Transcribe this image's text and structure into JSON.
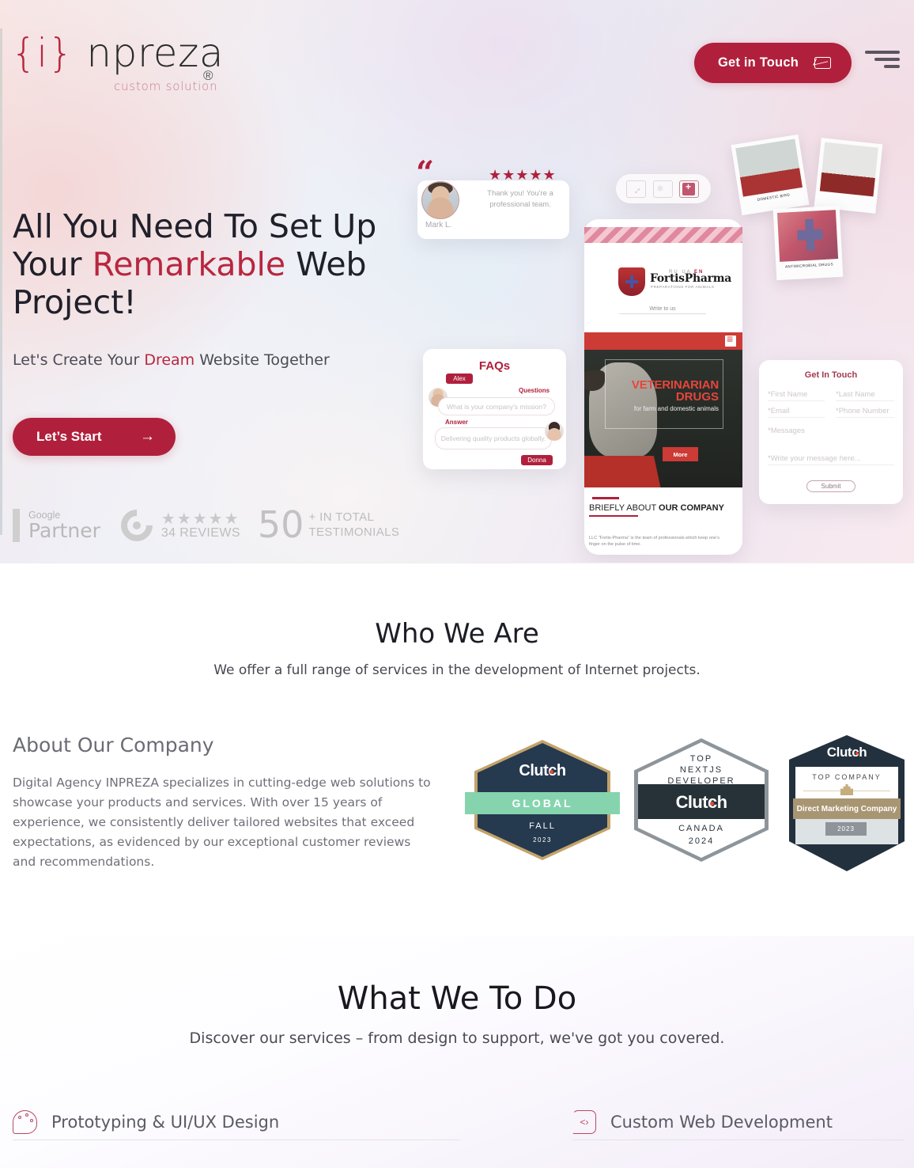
{
  "header": {
    "logo_main": "npreza",
    "logo_brace_open": "{i}",
    "logo_reg": "®",
    "logo_tagline": "custom solution",
    "cta_label": "Get in Touch",
    "cta_icon": "envelope-icon",
    "menu_icon": "hamburger-menu-icon"
  },
  "hero": {
    "title_line1": "All You Need To Set Up",
    "title_line2_a": "Your ",
    "title_line2_accent": "Remarkable",
    "title_line2_b": " Web",
    "title_line3": "Project!",
    "subtitle_a": "Let's Create Your ",
    "subtitle_accent": "Dream",
    "subtitle_b": " Website Together",
    "button_label": "Let’s Start",
    "button_arrow": "→"
  },
  "trust": {
    "google_small": "Google",
    "google_big": "Partner",
    "clutch_icon": "clutch-logo-icon",
    "stars": "★★★★★",
    "reviews": "34 REVIEWS",
    "count": "50",
    "total_line1": "+ IN TOTAL",
    "total_line2": "TESTIMONIALS"
  },
  "mock": {
    "testimonial": {
      "stars": "★★★★★",
      "text": "Thank you! You're a professional team.",
      "name": "Mark L."
    },
    "toolbar": {
      "icon1": "resize-arrows-icon",
      "icon2": "tag-icon",
      "icon3": "medicine-bottle-icon"
    },
    "faq": {
      "title": "FAQs",
      "asker": "Alex",
      "answerer": "Donna",
      "question_label": "Questions",
      "question_text": "What is your company's mission?",
      "answer_label": "Answer",
      "answer_text": "Delivering quality products globally."
    },
    "phone": {
      "langs_a": "RU",
      "langs_b": "UA",
      "langs_active": "EN",
      "brand": "FortisPharma",
      "brand_sub": "PREPARATIONS FOR ANIMALS",
      "write_link": "Write to us",
      "hero_l1": "VETERINARIAN",
      "hero_l2": "DRUGS",
      "hero_l3": "for farm and domestic animals",
      "more_btn": "More",
      "about_a": "BRIEFLY ABOUT ",
      "about_b": "OUR COMPANY",
      "about_body": "LLC “Fortis-Pharma” is the team of professionals which keep one’s finger on the pulse of time."
    },
    "contact": {
      "title": "Get In Touch",
      "first_name": "*First Name",
      "last_name": "*Last Name",
      "email": "*Email",
      "phone": "*Phone Number",
      "messages": "*Messages",
      "message_placeholder": "*Write your message here...",
      "submit": "Submit"
    },
    "polaroids": [
      {
        "caption": "DOMESTIC BIRD"
      },
      {
        "caption": ""
      },
      {
        "caption": "ANTIMICROBIAL DRUGS"
      }
    ]
  },
  "who_we_are": {
    "heading": "Who We Are",
    "subheading": "We offer a full range of services in the development of Internet projects.",
    "about_heading": "About Our Company",
    "about_body": "Digital Agency INPREZA specializes in cutting-edge web solutions to showcase your products and services. With over 15 years of experience, we consistently deliver tailored websites that exceed expectations, as evidenced by our exceptional customer reviews and recommendations."
  },
  "badges": [
    {
      "brand": "Clutch",
      "ribbon": "GLOBAL",
      "season": "FALL",
      "year": "2023"
    },
    {
      "line1": "TOP",
      "line2": "NEXTJS",
      "line3": "DEVELOPER",
      "brand": "Clutch",
      "country": "CANADA",
      "year": "2024"
    },
    {
      "brand": "Clutch",
      "top": "TOP COMPANY",
      "category": "Direct Marketing Company",
      "year": "2023"
    }
  ],
  "what_we_do": {
    "heading": "What We To Do",
    "subheading": "Discover our services – from design to support, we've got you covered.",
    "services": [
      {
        "label": "Prototyping & UI/UX Design",
        "icon": "palette-icon"
      },
      {
        "label": "Custom Web Development",
        "icon": "code-brackets-icon"
      }
    ]
  },
  "colors": {
    "brand_red": "#b0203c",
    "accent_red": "#b8273f",
    "badge_navy": "#25394f",
    "badge_gold": "#c3a36a",
    "badge_mint": "#86d4ae"
  }
}
